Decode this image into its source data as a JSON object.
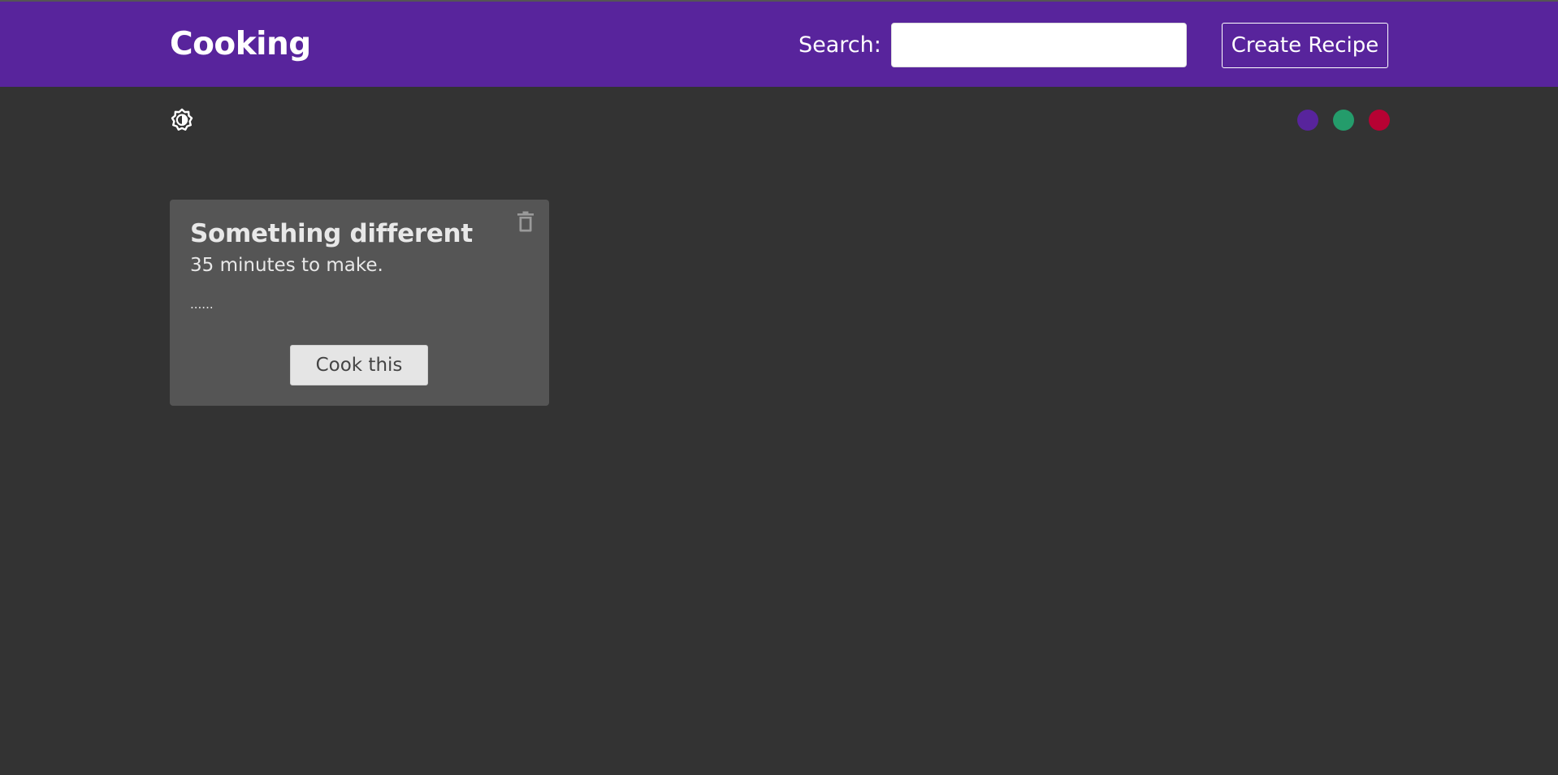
{
  "header": {
    "brand": "Cooking",
    "search_label": "Search:",
    "search_value": "",
    "create_button": "Create Recipe",
    "color": "#58249c"
  },
  "toolbar": {
    "theme_toggle_icon": "brightness-contrast-icon",
    "swatches": [
      {
        "name": "purple",
        "color": "#58249c"
      },
      {
        "name": "green",
        "color": "#249c6b"
      },
      {
        "name": "red",
        "color": "#b70233"
      }
    ]
  },
  "recipes": [
    {
      "title": "Something different",
      "time": "35 minutes to make.",
      "description": "......",
      "button": "Cook this",
      "delete_icon": "trash-icon"
    }
  ]
}
